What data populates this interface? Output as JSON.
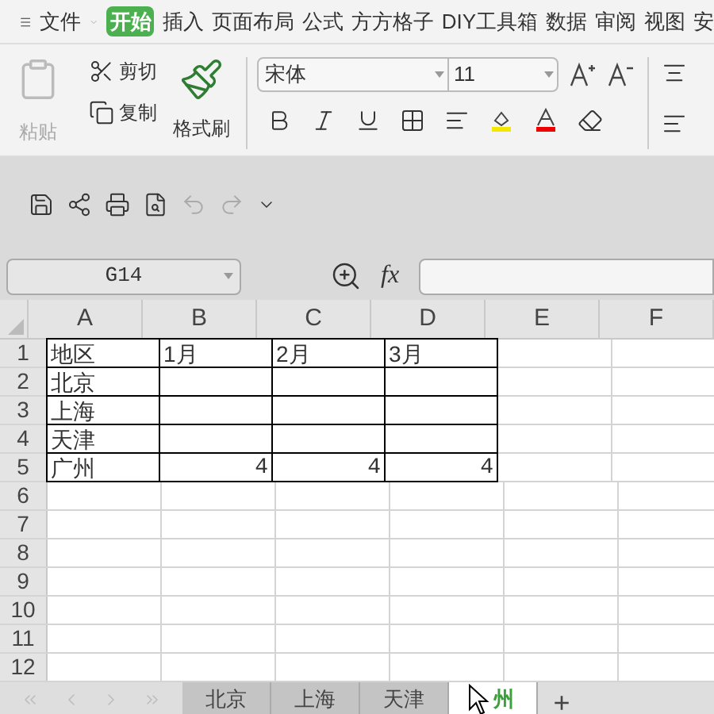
{
  "menu": [
    {
      "label": "文件",
      "selected": false
    },
    {
      "label": "开始",
      "selected": true
    },
    {
      "label": "插入",
      "selected": false
    },
    {
      "label": "页面布局",
      "selected": false
    },
    {
      "label": "公式",
      "selected": false
    },
    {
      "label": "方方格子",
      "selected": false
    },
    {
      "label": "DIY工具箱",
      "selected": false
    },
    {
      "label": "数据",
      "selected": false
    },
    {
      "label": "审阅",
      "selected": false
    },
    {
      "label": "视图",
      "selected": false
    },
    {
      "label": "安",
      "selected": false
    }
  ],
  "ribbon": {
    "paste": "粘贴",
    "cut": "剪切",
    "copy": "复制",
    "format_painter": "格式刷",
    "font_name": "宋体",
    "font_size": "11"
  },
  "formula_bar": {
    "name_box": "G14",
    "fx": "fx"
  },
  "columns": [
    "A",
    "B",
    "C",
    "D",
    "E",
    "F"
  ],
  "rows": [
    {
      "header": "1",
      "cells": [
        {
          "kind": "text",
          "text": "地区"
        },
        {
          "kind": "text",
          "text": "1月"
        },
        {
          "kind": "text",
          "text": "2月"
        },
        {
          "kind": "text",
          "text": "3月"
        }
      ]
    },
    {
      "header": "2",
      "cells": [
        {
          "kind": "text",
          "text": "北京"
        },
        {
          "kind": "empty"
        },
        {
          "kind": "empty"
        },
        {
          "kind": "empty"
        }
      ]
    },
    {
      "header": "3",
      "cells": [
        {
          "kind": "text",
          "text": "上海"
        },
        {
          "kind": "empty"
        },
        {
          "kind": "empty"
        },
        {
          "kind": "empty"
        }
      ]
    },
    {
      "header": "4",
      "cells": [
        {
          "kind": "text",
          "text": "天津"
        },
        {
          "kind": "empty"
        },
        {
          "kind": "empty"
        },
        {
          "kind": "empty"
        }
      ]
    },
    {
      "header": "5",
      "cells": [
        {
          "kind": "text",
          "text": "广州"
        },
        {
          "kind": "number",
          "text": "4"
        },
        {
          "kind": "number",
          "text": "4"
        },
        {
          "kind": "number",
          "text": "4"
        }
      ]
    },
    {
      "header": "6",
      "cells": []
    },
    {
      "header": "7",
      "cells": []
    },
    {
      "header": "8",
      "cells": []
    },
    {
      "header": "9",
      "cells": []
    },
    {
      "header": "10",
      "cells": []
    },
    {
      "header": "11",
      "cells": []
    },
    {
      "header": "12",
      "cells": []
    }
  ],
  "sheet_tabs": [
    {
      "label": "北京",
      "selected": false
    },
    {
      "label": "上海",
      "selected": false
    },
    {
      "label": "天津",
      "selected": false
    },
    {
      "label": "州",
      "selected": true
    }
  ],
  "add_sheet": "+"
}
